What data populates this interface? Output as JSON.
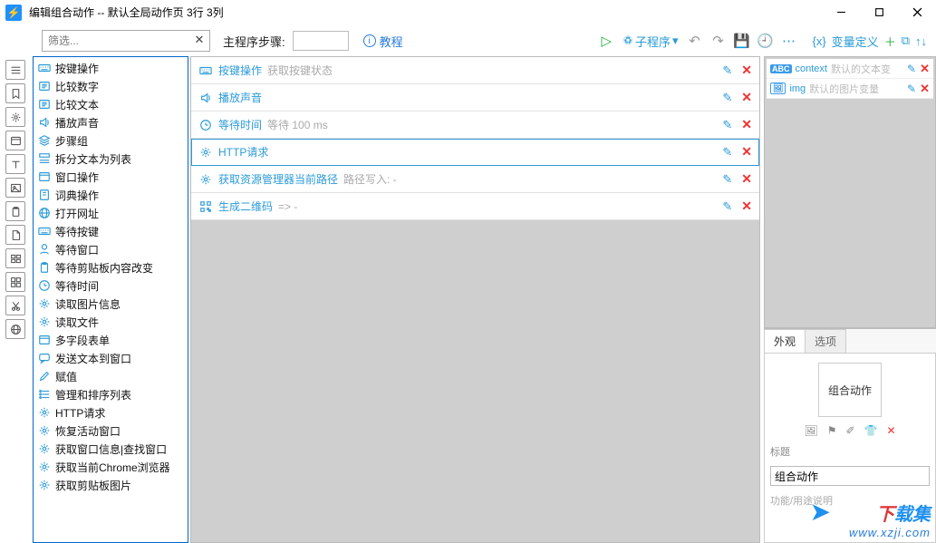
{
  "title": "编辑组合动作 -- 默认全局动作页 3行 3列",
  "filter_placeholder": "筛选...",
  "main_steps_label": "主程序步骤:",
  "tutorial_label": "教程",
  "subroutine_label": "子程序",
  "var_def_label": "变量定义",
  "leftrail_names": [
    "menu",
    "bookmark",
    "gear",
    "window",
    "text",
    "image",
    "clipboard",
    "file",
    "windows",
    "grid",
    "cut",
    "globe"
  ],
  "actionlib": [
    "按键操作",
    "比较数字",
    "比较文本",
    "播放声音",
    "步骤组",
    "拆分文本为列表",
    "窗口操作",
    "词典操作",
    "打开网址",
    "等待按键",
    "等待窗口",
    "等待剪贴板内容改变",
    "等待时间",
    "读取图片信息",
    "读取文件",
    "多字段表单",
    "发送文本到窗口",
    "赋值",
    "管理和排序列表",
    "HTTP请求",
    "恢复活动窗口",
    "获取窗口信息|查找窗口",
    "获取当前Chrome浏览器",
    "获取剪贴板图片"
  ],
  "actionlib_icons": [
    "keyboard",
    "compare",
    "compare",
    "sound",
    "layers",
    "split",
    "window",
    "dict",
    "globe",
    "keyboard",
    "user",
    "clipboard",
    "clock",
    "gear",
    "gear",
    "window",
    "chat",
    "edit",
    "list",
    "gear",
    "gear",
    "gear",
    "gear",
    "gear"
  ],
  "steps": [
    {
      "icon": "keyboard",
      "label": "按键操作",
      "detail": "获取按键状态"
    },
    {
      "icon": "sound",
      "label": "播放声音",
      "detail": ""
    },
    {
      "icon": "clock",
      "label": "等待时间",
      "detail": "等待 100 ms"
    },
    {
      "icon": "gear",
      "label": "HTTP请求",
      "detail": "",
      "selected": true
    },
    {
      "icon": "gear",
      "label": "获取资源管理器当前路径",
      "detail": "路径写入: -"
    },
    {
      "icon": "qrcode",
      "label": "生成二维码",
      "detail": "=> -"
    }
  ],
  "vars": [
    {
      "type": "ABC",
      "name": "context",
      "desc": "默认的文本变"
    },
    {
      "type": "img",
      "name": "img",
      "desc": "默认的图片变量"
    }
  ],
  "prop_tabs": {
    "appearance": "外观",
    "options": "选项"
  },
  "preview_text": "组合动作",
  "title_label": "标题",
  "title_value": "组合动作",
  "usage_label": "功能/用途说明",
  "watermark_brand": "下载集",
  "watermark_url": "www.xzji.com"
}
